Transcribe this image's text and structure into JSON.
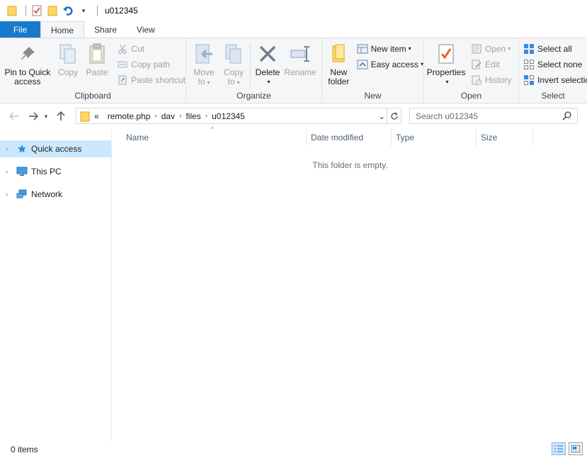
{
  "window": {
    "title": "u012345"
  },
  "tabs": [
    {
      "label": "File"
    },
    {
      "label": "Home"
    },
    {
      "label": "Share"
    },
    {
      "label": "View"
    }
  ],
  "ribbon": {
    "clipboard": {
      "label": "Clipboard",
      "pin_label_1": "Pin to Quick",
      "pin_label_2": "access",
      "copy": "Copy",
      "paste": "Paste",
      "cut": "Cut",
      "copy_path": "Copy path",
      "paste_shortcut": "Paste shortcut"
    },
    "organize": {
      "label": "Organize",
      "move_to_1": "Move",
      "move_to_2": "to",
      "copy_to_1": "Copy",
      "copy_to_2": "to",
      "delete": "Delete",
      "rename": "Rename"
    },
    "new": {
      "label": "New",
      "new_folder_1": "New",
      "new_folder_2": "folder",
      "new_item": "New item",
      "easy_access": "Easy access"
    },
    "open": {
      "label": "Open",
      "properties": "Properties",
      "open": "Open",
      "edit": "Edit",
      "history": "History"
    },
    "select": {
      "label": "Select",
      "select_all": "Select all",
      "select_none": "Select none",
      "invert_selection": "Invert selection"
    }
  },
  "address": {
    "overflow": "«",
    "crumbs": [
      "remote.php",
      "dav",
      "files",
      "u012345"
    ]
  },
  "search": {
    "placeholder": "Search u012345"
  },
  "navpane": {
    "items": [
      {
        "label": "Quick access"
      },
      {
        "label": "This PC"
      },
      {
        "label": "Network"
      }
    ]
  },
  "filelist": {
    "columns": [
      "Name",
      "Date modified",
      "Type",
      "Size"
    ],
    "empty_message": "This folder is empty."
  },
  "status": {
    "items_count": "0 items"
  },
  "colors": {
    "accent": "#1979ca",
    "selection": "#cce8ff",
    "header_text": "#4c607a"
  }
}
